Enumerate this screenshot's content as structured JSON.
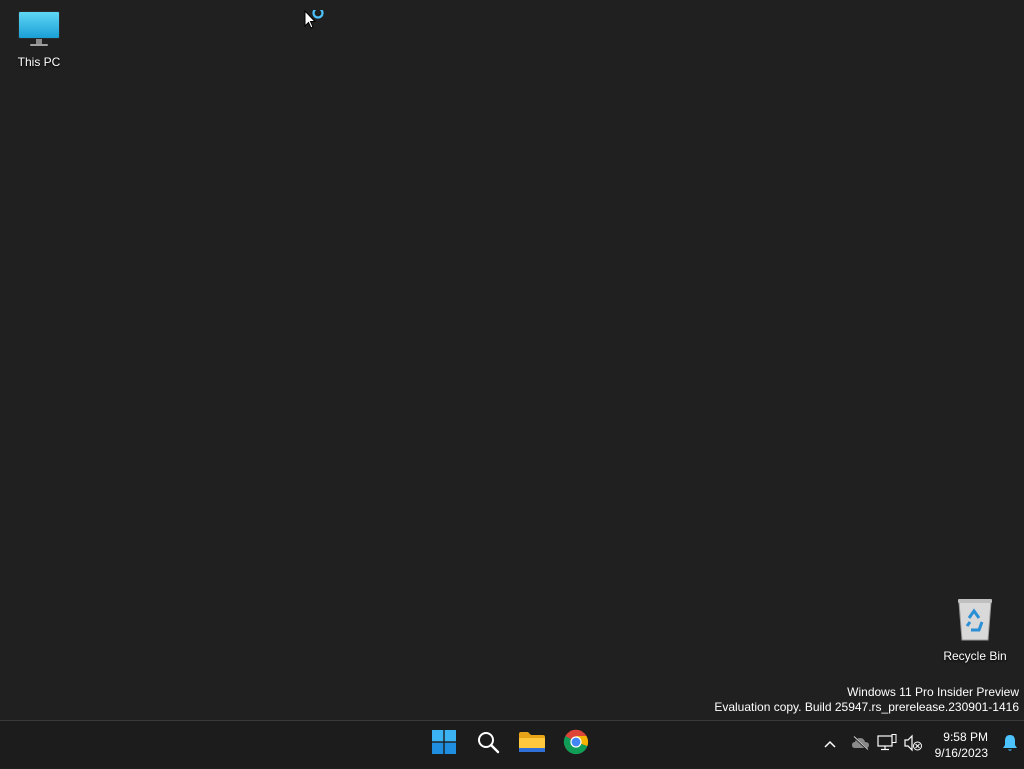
{
  "desktop": {
    "icons": [
      {
        "label": "This PC",
        "icon": "monitor-icon"
      },
      {
        "label": "Recycle Bin",
        "icon": "recycle-bin-icon"
      }
    ],
    "watermark": {
      "line1": "Windows 11 Pro Insider Preview",
      "line2": "Evaluation copy. Build 25947.rs_prerelease.230901-1416"
    }
  },
  "taskbar": {
    "apps": [
      {
        "name": "Start",
        "icon": "windows-start-icon"
      },
      {
        "name": "Search",
        "icon": "search-icon"
      },
      {
        "name": "File Explorer",
        "icon": "folder-icon"
      },
      {
        "name": "Google Chrome",
        "icon": "chrome-icon"
      }
    ],
    "tray": {
      "chevron_icon": "chevron-up-icon",
      "icons": [
        "onedrive-offline-icon",
        "network-icon",
        "volume-muted-icon"
      ],
      "time": "9:58 PM",
      "date": "9/16/2023",
      "notification_icon": "bell-icon"
    }
  },
  "colors": {
    "desktop_bg": "#202020",
    "taskbar_bg": "#1c1c1c",
    "accent": "#4cc2ff"
  }
}
